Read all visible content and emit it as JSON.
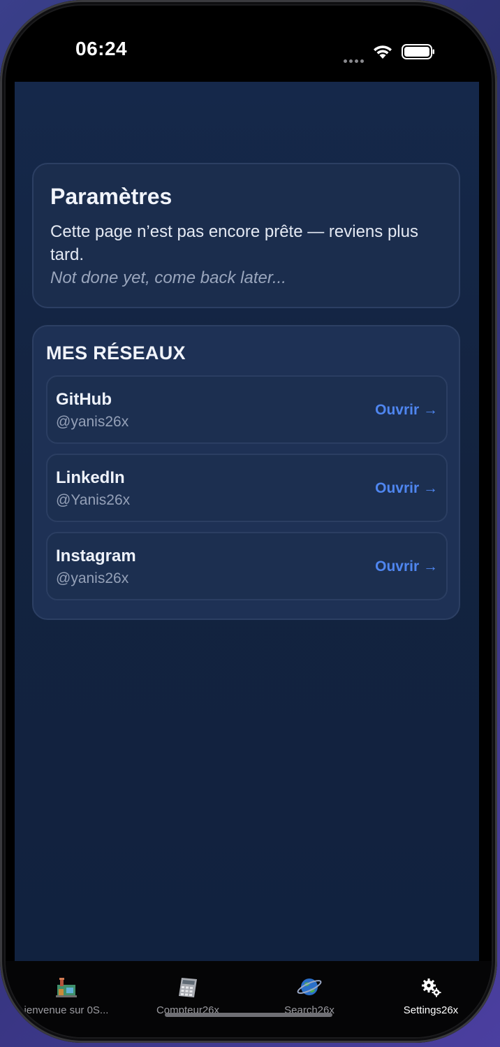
{
  "status_bar": {
    "time": "06:24"
  },
  "params_card": {
    "title": "Paramètres",
    "text": "Cette page n’est pas encore prête — reviens plus tard.",
    "subtext": "Not done yet, come back later..."
  },
  "networks": {
    "title": "MES RÉSEAUX",
    "items": [
      {
        "name": "GitHub",
        "handle": "@yanis26x",
        "action": "Ouvrir →"
      },
      {
        "name": "LinkedIn",
        "handle": "@Yanis26x",
        "action": "Ouvrir →"
      },
      {
        "name": "Instagram",
        "handle": "@yanis26x",
        "action": "Ouvrir →"
      }
    ]
  },
  "tab_bar": {
    "tabs": [
      {
        "label": "ienvenue sur 0S...",
        "icon": "factory-icon"
      },
      {
        "label": "Compteur26x",
        "icon": "calculator-icon"
      },
      {
        "label": "Search26x",
        "icon": "globe-icon"
      },
      {
        "label": "Settings26x",
        "icon": "gears-icon"
      }
    ],
    "active_index": 3
  },
  "colors": {
    "accent": "#4f86f0",
    "background": "#13233f",
    "card": "#1b2d4d"
  }
}
